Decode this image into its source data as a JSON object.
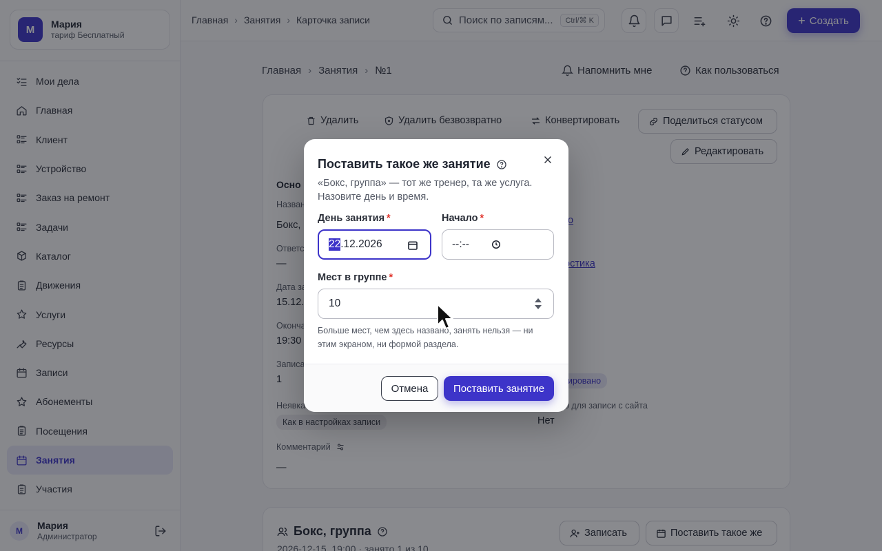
{
  "profile": {
    "initial": "М",
    "name": "Мария",
    "plan": "тариф Бесплатный"
  },
  "sidebar": {
    "items": [
      {
        "label": "Мои дела",
        "icon": "checklist-icon"
      },
      {
        "label": "Главная",
        "icon": "home-icon"
      },
      {
        "label": "Клиент",
        "icon": "list-icon"
      },
      {
        "label": "Устройство",
        "icon": "list-icon"
      },
      {
        "label": "Заказ на ремонт",
        "icon": "list-icon"
      },
      {
        "label": "Задачи",
        "icon": "list-icon"
      },
      {
        "label": "Каталог",
        "icon": "box-icon"
      },
      {
        "label": "Движения",
        "icon": "clipboard-icon"
      },
      {
        "label": "Услуги",
        "icon": "star-icon"
      },
      {
        "label": "Ресурсы",
        "icon": "wrench-icon"
      },
      {
        "label": "Записи",
        "icon": "calendar-icon"
      },
      {
        "label": "Абонементы",
        "icon": "star-icon"
      },
      {
        "label": "Посещения",
        "icon": "clipboard-icon"
      },
      {
        "label": "Занятия",
        "icon": "calendar-icon",
        "active": true
      },
      {
        "label": "Участия",
        "icon": "clipboard-icon"
      }
    ]
  },
  "user": {
    "initial": "М",
    "name": "Мария",
    "role": "Администратор"
  },
  "topbar": {
    "breadcrumbs": [
      "Главная",
      "Занятия",
      "Карточка записи"
    ],
    "search_placeholder": "Поиск по записям...",
    "search_hint": "Ctrl/⌘ K",
    "create_label": "Создать"
  },
  "main": {
    "breadcrumbs": [
      "Главная",
      "Занятия",
      "№1"
    ],
    "remind_label": "Напомнить мне",
    "howto_label": "Как пользоваться"
  },
  "card": {
    "delete_label": "Удалить",
    "delete_forever_label": "Удалить безвозвратно",
    "convert_label": "Конвертировать",
    "share_label": "Поделиться статусом",
    "edit_label": "Редактировать",
    "section_head": "Осно",
    "name_label": "Назван",
    "name_value": "Бокс,",
    "resp_label": "Ответс",
    "resp_value": "—",
    "date_label": "Дата за",
    "date_value": "15.12.2",
    "end_label": "Оконча",
    "end_value": "19:30",
    "booked_label": "Записа",
    "booked_value": "1",
    "link1": "о",
    "link2": "остика",
    "status_chip": "нировано",
    "noshow_label": "Неявка",
    "noshow_chip": "Как в настройках записи",
    "site_label": "о для записи с сайта",
    "site_value": "Нет",
    "comment_label": "Комментарий",
    "comment_value": "—"
  },
  "card2": {
    "title": "Бокс, группа",
    "subtitle": "2026-12-15, 19:00 · занято 1 из 10",
    "enroll_label": "Записать",
    "repeat_label": "Поставить такое же"
  },
  "modal": {
    "title": "Поставить такое же занятие",
    "description": "«Бокс, группа» — тот же тренер, та же услуга. Назовите день и время.",
    "day_label": "День занятия",
    "day_value_selected": "22",
    "day_value_rest": ".12.2026",
    "start_label": "Начало",
    "start_value": "--:--",
    "seats_label": "Мест в группе",
    "seats_value": "10",
    "hint": "Больше мест, чем здесь названо, занять нельзя — ни этим экраном, ни формой раздела.",
    "cancel_label": "Отмена",
    "submit_label": "Поставить занятие",
    "required_mark": "*"
  },
  "colors": {
    "accent": "#3d34c9",
    "required": "#e0322a"
  }
}
